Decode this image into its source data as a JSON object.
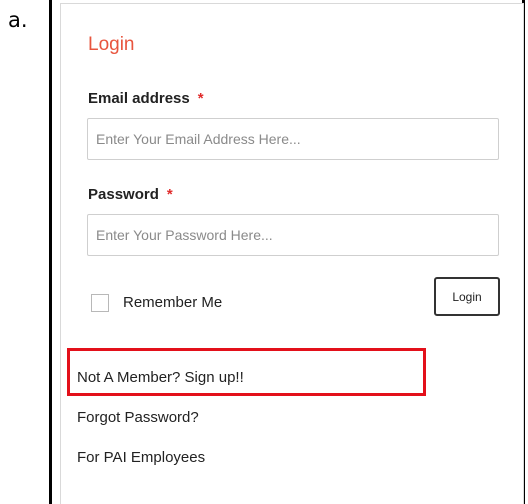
{
  "figure_label": "a.",
  "login_form": {
    "title": "Login",
    "email": {
      "label": "Email address",
      "required_mark": "*",
      "placeholder": "Enter Your Email Address Here..."
    },
    "password": {
      "label": "Password",
      "required_mark": "*",
      "placeholder": "Enter Your Password Here..."
    },
    "remember_me": {
      "label": "Remember Me",
      "checked": false
    },
    "submit_label": "Login"
  },
  "links": [
    {
      "label": "Not A Member? Sign up!!",
      "highlighted": true
    },
    {
      "label": "Forgot Password?"
    },
    {
      "label": "For PAI Employees"
    }
  ],
  "colors": {
    "title": "#e8553e",
    "required": "#e02b2b",
    "highlight_box": "#e3101a",
    "text": "#222222",
    "input_border": "#cfcfcf"
  }
}
